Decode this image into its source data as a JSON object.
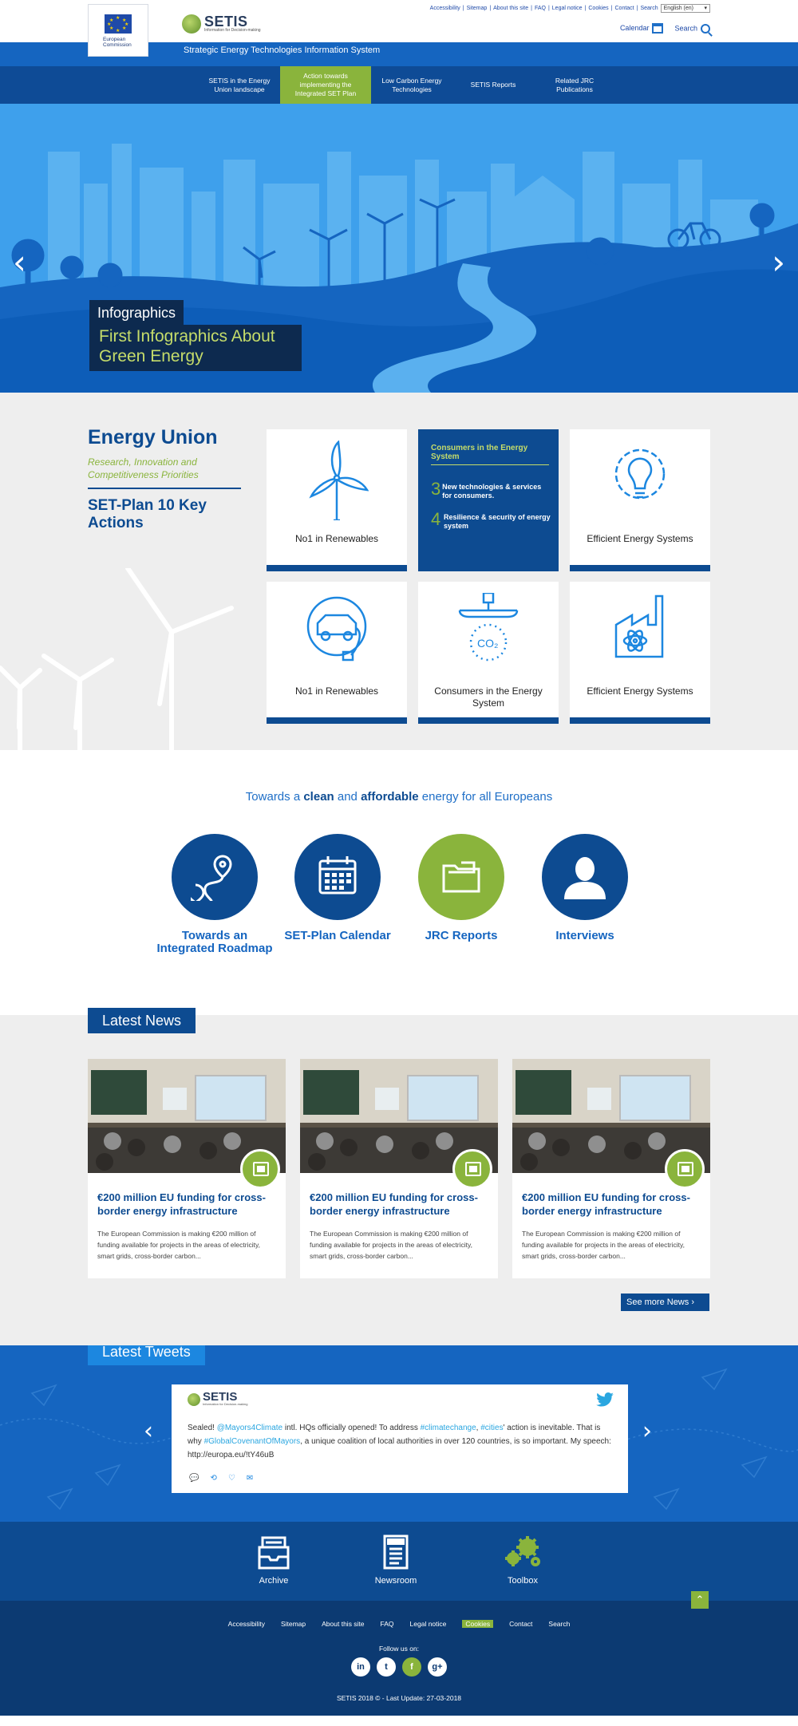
{
  "header": {
    "ec_logo_text": "European Commission",
    "brand": "SETIS",
    "brand_sub": "Information for Decision-making",
    "util_links": [
      "Accessibility",
      "Sitemap",
      "About this site",
      "FAQ",
      "Legal notice",
      "Cookies",
      "Contact",
      "Search"
    ],
    "language": "English (en)",
    "calendar_label": "Calendar",
    "search_label": "Search",
    "tagline": "Strategic Energy Technologies Information System"
  },
  "nav": [
    {
      "label": "SETIS in the Energy Union landscape"
    },
    {
      "label": "Action towards implementing the Integrated SET Plan"
    },
    {
      "label": "Low Carbon Energy Technologies"
    },
    {
      "label": "SETIS Reports"
    },
    {
      "label": "Related JRC Publications"
    }
  ],
  "hero": {
    "category": "Infographics",
    "title": "First Infographics About Green Energy",
    "prev": "‹",
    "next": "›"
  },
  "energy_union": {
    "title": "Energy Union",
    "subtitle": "Research, Innovation and Competitiveness Priorities",
    "setplan": "SET-Plan 10 Key Actions",
    "cards": [
      {
        "label": "No1 in Renewables",
        "icon": "wind-turbine-icon"
      },
      {
        "label": "Consumers in the Energy System",
        "icon": "info-card"
      },
      {
        "label": "Efficient Energy Systems",
        "icon": "lightbulb-gear-icon"
      },
      {
        "label": "No1 in Renewables",
        "icon": "electric-car-icon"
      },
      {
        "label": "Consumers in the Energy System",
        "icon": "co2-capture-icon"
      },
      {
        "label": "Efficient Energy Systems",
        "icon": "nuclear-plant-icon"
      }
    ],
    "featured": {
      "title": "Consumers in the Energy System",
      "items": [
        {
          "num": "3",
          "text": "New technologies & services for consumers."
        },
        {
          "num": "4",
          "text": "Resilience & security of energy system"
        }
      ]
    }
  },
  "quick": {
    "title_parts": [
      "Towards a ",
      "clean",
      " and ",
      "affordable",
      " energy for all Europeans"
    ],
    "links": [
      {
        "label": "Towards an Integrated Roadmap",
        "icon": "roadmap-pin-icon"
      },
      {
        "label": "SET-Plan Calendar",
        "icon": "calendar-icon"
      },
      {
        "label": "JRC Reports",
        "icon": "folder-icon"
      },
      {
        "label": "Interviews",
        "icon": "person-icon"
      }
    ]
  },
  "news": {
    "heading": "Latest News",
    "items": [
      {
        "title": "€200 million EU funding for cross-border energy infrastructure",
        "text": "The European Commission is making €200 million of funding available for projects in the areas of electricity, smart grids, cross-border carbon..."
      },
      {
        "title": "€200 million EU funding for cross-border energy infrastructure",
        "text": "The European Commission is making €200 million of funding available for projects in the areas of electricity, smart grids, cross-border carbon..."
      },
      {
        "title": "€200 million EU funding for cross-border energy infrastructure",
        "text": "The European Commission is making €200 million of funding available for projects in the areas of electricity, smart grids, cross-border carbon..."
      }
    ],
    "see_more": "See more News"
  },
  "tweets": {
    "heading": "Latest Tweets",
    "brand": "SETIS",
    "brand_sub": "Information for Decision-making",
    "parts": [
      {
        "t": "Sealed! ",
        "hl": false
      },
      {
        "t": "@Mayors4Climate",
        "hl": true
      },
      {
        "t": " intl. HQs officially opened! To address ",
        "hl": false
      },
      {
        "t": "#climatechange",
        "hl": true
      },
      {
        "t": ", ",
        "hl": false
      },
      {
        "t": "#cities",
        "hl": true
      },
      {
        "t": "' action is inevitable. That is why ",
        "hl": false
      },
      {
        "t": "#GlobalCovenantOfMayors",
        "hl": true
      },
      {
        "t": ", a unique coalition of local authorities in over 120 countries, is so important. My speech: http://europa.eu/!tY46uB",
        "hl": false
      }
    ]
  },
  "footer": {
    "quick": [
      {
        "label": "Archive",
        "icon": "archive-icon"
      },
      {
        "label": "Newsroom",
        "icon": "newsroom-icon"
      },
      {
        "label": "Toolbox",
        "icon": "toolbox-gears-icon"
      }
    ],
    "links": [
      "Accessibility",
      "Sitemap",
      "About this site",
      "FAQ",
      "Legal notice",
      "Cookies",
      "Contact",
      "Search"
    ],
    "follow": "Follow us on:",
    "socials": [
      "in",
      "t",
      "f",
      "g+"
    ],
    "copyright": "SETIS 2018 © - Last Update: 27-03-2018"
  },
  "colors": {
    "primary_blue": "#0d4b91",
    "bright_blue": "#1565c0",
    "accent_green": "#8ab43c"
  }
}
